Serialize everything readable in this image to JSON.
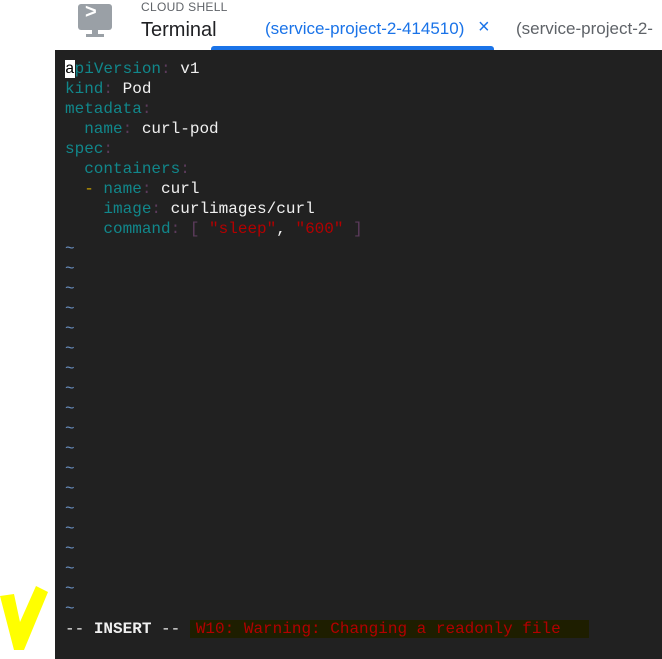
{
  "header": {
    "section_label": "CLOUD SHELL",
    "title": "Terminal",
    "tabs": [
      {
        "label": "(service-project-2-414510)",
        "active": true
      },
      {
        "label": "(service-project-2-",
        "active": false
      }
    ],
    "close_icon": "×"
  },
  "editor": {
    "lines": [
      {
        "key": "apiVersion",
        "value": "v1",
        "indent": ""
      },
      {
        "key": "kind",
        "value": "Pod",
        "indent": ""
      },
      {
        "key": "metadata",
        "value": "",
        "indent": ""
      },
      {
        "key": "name",
        "value": "curl-pod",
        "indent": "  "
      },
      {
        "key": "spec",
        "value": "",
        "indent": ""
      },
      {
        "key": "containers",
        "value": "",
        "indent": "  "
      },
      {
        "key": "name",
        "value": "curl",
        "indent": "  ",
        "dash": "- "
      },
      {
        "key": "image",
        "value": "curlimages/curl",
        "indent": "    "
      },
      {
        "key": "command",
        "indent": "    ",
        "list": [
          "\"sleep\"",
          "\"600\""
        ]
      }
    ],
    "empty_line_marker": "~",
    "empty_line_count": 19,
    "mode": "-- INSERT --",
    "warning": "W10: Warning: Changing a readonly file"
  },
  "colors": {
    "accent": "#1a73e8",
    "terminal_bg": "#212121",
    "yaml_key": "#11878b",
    "string": "#b30000",
    "annotation": "#ffff00"
  }
}
